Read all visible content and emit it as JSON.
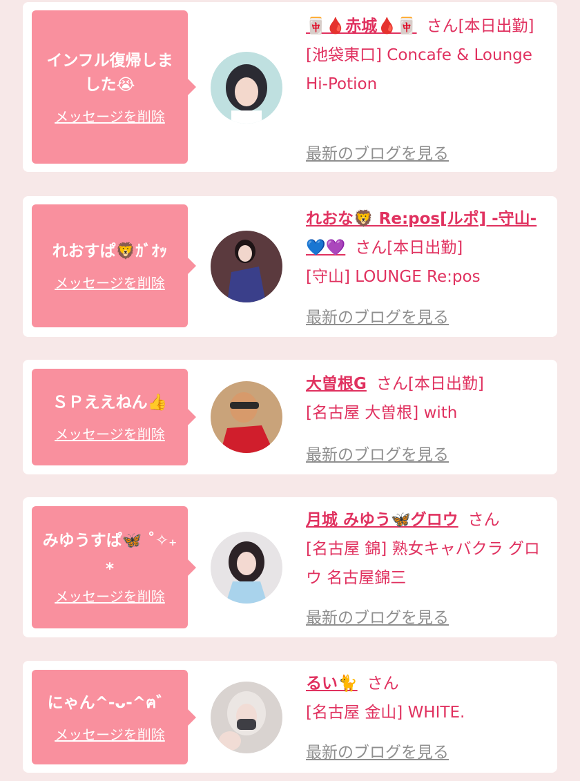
{
  "delete_label": "メッセージを削除",
  "blog_label": "最新のブログを見る",
  "suffix": "さん",
  "theme": {
    "background": "#f7e8e8",
    "bubble": "#f9909e",
    "accent": "#e0315f",
    "link_gray": "#8f8f8f"
  },
  "items": [
    {
      "message": "インフル復帰しました😭",
      "name": "🀄🩸赤城🩸🀄",
      "status": "[本日出勤]",
      "shop": "[池袋東口] Concafe & Lounge Hi-Potion",
      "avatar": "girl-avatar"
    },
    {
      "message": "れおすぱ🦁ｶﾞｵｯ",
      "name": "れおな🦁 Re:pos[ルポ] -守山-💙💜",
      "status": "[本日出勤]",
      "shop": "[守山] LOUNGE Re:pos",
      "avatar": "girl-avatar"
    },
    {
      "message": "ＳＰええねん👍",
      "name": "大曽根G",
      "status": "[本日出勤]",
      "shop": "[名古屋 大曽根] with",
      "avatar": "man-avatar"
    },
    {
      "message": "みゆうすぱ🦋 ˚✧₊⁎",
      "name": "月城 みゆう🦋グロウ",
      "status": "",
      "shop": "[名古屋 錦] 熟女キャバクラ グロウ 名古屋錦三",
      "avatar": "girl-avatar"
    },
    {
      "message": "にゃん^-ᴗ-^ฅ゛",
      "name": "るい🐈",
      "status": "",
      "shop": "[名古屋 金山] WHITE.",
      "avatar": "girl-avatar"
    }
  ]
}
